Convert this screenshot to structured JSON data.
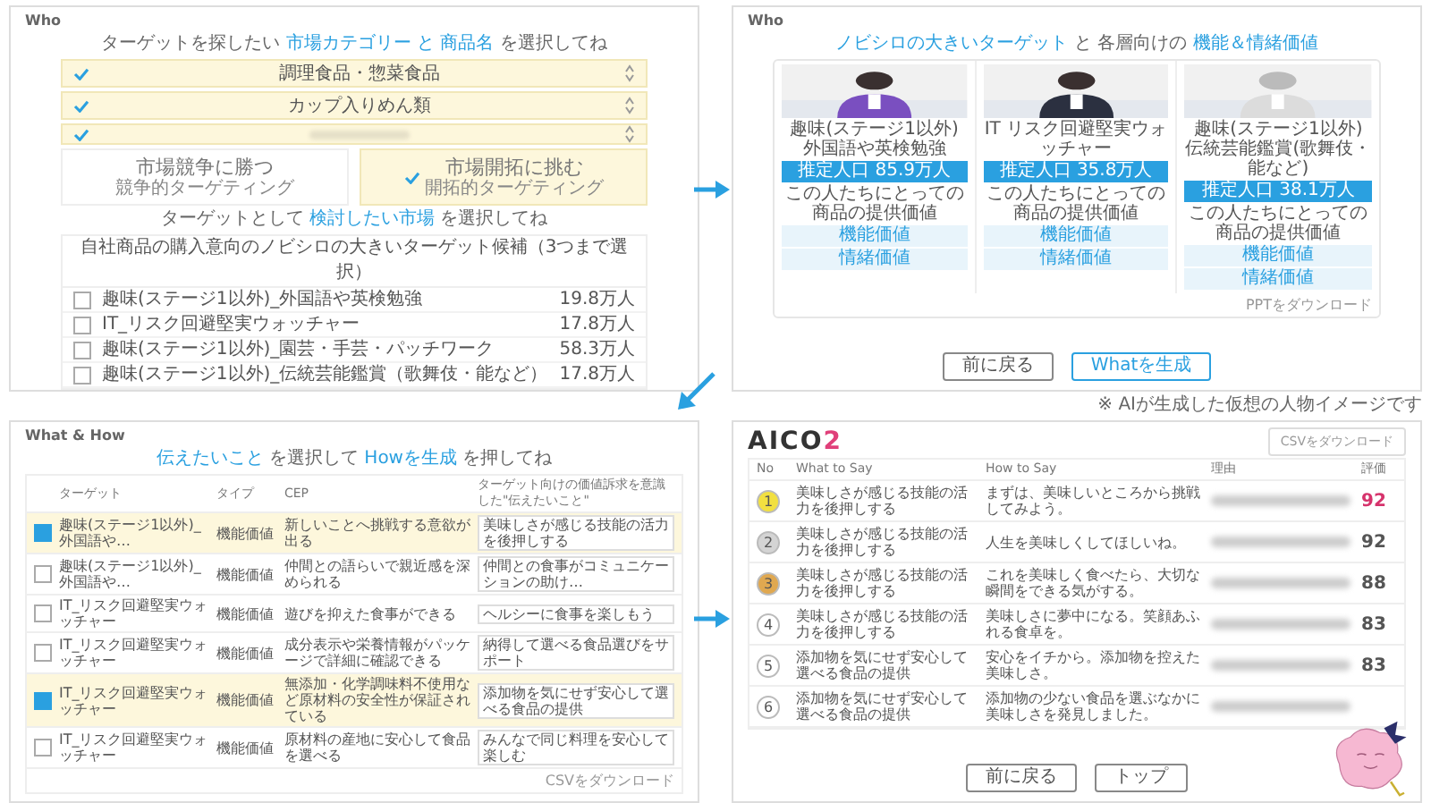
{
  "who_select": {
    "section": "Who",
    "heading": [
      {
        "text": "ターゲットを探したい ",
        "highlight": false
      },
      {
        "text": "市場カテゴリー",
        "highlight": true
      },
      {
        "text": " と ",
        "highlight": true
      },
      {
        "text": "商品名",
        "highlight": true
      },
      {
        "text": " を選択してね",
        "highlight": false
      }
    ],
    "selects": [
      {
        "value": "調理食品・惣菜食品",
        "checked": true
      },
      {
        "value": "カップ入りめん類",
        "checked": true
      },
      {
        "checked": true
      }
    ],
    "options": [
      {
        "title": "市場競争に勝つ",
        "subtitle": "競争的ターゲティング",
        "selected": false
      },
      {
        "title": "市場開拓に挑む",
        "subtitle": "開拓的ターゲティング",
        "selected": true
      }
    ],
    "heading2": [
      {
        "text": "ターゲットとして ",
        "highlight": false
      },
      {
        "text": "検討したい市場",
        "highlight": true
      },
      {
        "text": " を選択してね",
        "highlight": false
      }
    ],
    "list_header": "自社商品の購入意向のノビシロの大きいターゲット候補（3つまで選択）",
    "rows": [
      {
        "name": "趣味(ステージ1以外)_外国語や英検勉強",
        "size": "19.8万人",
        "checked": false
      },
      {
        "name": "IT_リスク回避堅実ウォッチャー",
        "size": "17.8万人",
        "checked": false
      },
      {
        "name": "趣味(ステージ1以外)_園芸・手芸・パッチワーク",
        "size": "58.3万人",
        "checked": false
      },
      {
        "name": "趣味(ステージ1以外)_伝統芸能鑑賞（歌舞伎・能など）",
        "size": "17.8万人",
        "checked": false
      }
    ]
  },
  "who_targets": {
    "section": "Who",
    "heading": [
      {
        "text": "ノビシロの大きいターゲット",
        "highlight": true
      },
      {
        "text": " と 各層向けの ",
        "highlight": false
      },
      {
        "text": "機能＆情緒価値",
        "highlight": true
      }
    ],
    "cards": [
      {
        "name": "趣味(ステージ1以外) 外国語や英検勉強",
        "count": "推定人口 85.9万人",
        "value_title": "この人たちにとっての商品の提供価値",
        "labels": [
          "機能価値",
          "情緒価値"
        ]
      },
      {
        "name": "IT リスク回避堅実ウォッチャー",
        "count": "推定人口 35.8万人",
        "value_title": "この人たちにとっての商品の提供価値",
        "labels": [
          "機能価値",
          "情緒価値"
        ]
      },
      {
        "name": "趣味(ステージ1以外) 伝統芸能鑑賞(歌舞伎・能など)",
        "count": "推定人口 38.1万人",
        "value_title": "この人たちにとっての商品の提供価値",
        "labels": [
          "機能価値",
          "情緒価値"
        ]
      }
    ],
    "download": "PPTをダウンロード",
    "buttons": [
      {
        "label": "前に戻る",
        "kind": "secondary"
      },
      {
        "label": "Whatを生成",
        "kind": "primary"
      }
    ]
  },
  "caption": "※ AIが生成した仮想の人物イメージです",
  "what_how": {
    "section": "What & How",
    "heading": [
      {
        "text": "伝えたいこと",
        "highlight": true
      },
      {
        "text": " を選択して ",
        "highlight": false
      },
      {
        "text": "Howを生成",
        "highlight": true
      },
      {
        "text": " を押してね",
        "highlight": false
      }
    ],
    "columns": [
      "ターゲット",
      "タイプ",
      "CEP",
      "ターゲット向けの価値訴求を意識した\"伝えたいこと\""
    ],
    "rows": [
      {
        "checked": true,
        "target": "趣味(ステージ1以外)_外国語や…",
        "type": "機能価値",
        "cep": "新しいことへ挑戦する意欲が出る",
        "say": "美味しさが感じる技能の活力を後押しする"
      },
      {
        "checked": false,
        "target": "趣味(ステージ1以外)_外国語や…",
        "type": "機能価値",
        "cep": "仲間との語らいで親近感を深められる",
        "say": "仲間との食事がコミュニケーションの助け…"
      },
      {
        "checked": false,
        "target": "IT_リスク回避堅実ウォッチャー",
        "type": "機能価値",
        "cep": "遊びを抑えた食事ができる",
        "say": "ヘルシーに食事を楽しもう"
      },
      {
        "checked": false,
        "target": "IT_リスク回避堅実ウォッチャー",
        "type": "機能価値",
        "cep": "成分表示や栄養情報がパッケージで詳細に確認できる",
        "say": "納得して選べる食品選びをサポート"
      },
      {
        "checked": true,
        "target": "IT_リスク回避堅実ウォッチャー",
        "type": "機能価値",
        "cep": "無添加・化学調味料不使用など原材料の安全性が保証されている",
        "say": "添加物を気にせず安心して選べる食品の提供"
      },
      {
        "checked": false,
        "target": "IT_リスク回避堅実ウォッチャー",
        "type": "機能価値",
        "cep": "原材料の産地に安心して食品を選べる",
        "say": "みんなで同じ料理を安心して楽しむ"
      }
    ],
    "download": "CSVをダウンロード"
  },
  "results": {
    "logo": "AICO",
    "logo_accent": "2",
    "download": "CSVをダウンロード",
    "columns": [
      "No",
      "What to Say",
      "How to Say",
      "理由",
      "評価"
    ],
    "rows": [
      {
        "rank": "1",
        "color": "#f2e040",
        "what": "美味しさが感じる技能の活力を後押しする",
        "how": "まずは、美味しいところから挑戦してみよう。",
        "score": "92",
        "highlight": true
      },
      {
        "rank": "2",
        "color": "#d4d4d4",
        "what": "美味しさが感じる技能の活力を後押しする",
        "how": "人生を美味しくしてほしいね。",
        "score": "92",
        "highlight": false
      },
      {
        "rank": "3",
        "color": "#e0a850",
        "what": "美味しさが感じる技能の活力を後押しする",
        "how": "これを美味しく食べたら、大切な瞬間をできる気がする。",
        "score": "88",
        "highlight": false
      },
      {
        "rank": "4",
        "color": "#ffffff",
        "what": "美味しさが感じる技能の活力を後押しする",
        "how": "美味しさに夢中になる。笑顔あふれる食卓を。",
        "score": "83",
        "highlight": false
      },
      {
        "rank": "5",
        "color": "#ffffff",
        "what": "添加物を気にせず安心して選べる食品の提供",
        "how": "安心をイチから。添加物を控えた美味しさ。",
        "score": "83",
        "highlight": false
      },
      {
        "rank": "6",
        "color": "#ffffff",
        "what": "添加物を気にせず安心して選べる食品の提供",
        "how": "添加物の少ない食品を選ぶなかに美味しさを発見しました。"
      }
    ],
    "buttons": [
      {
        "label": "前に戻る"
      },
      {
        "label": "トップ"
      }
    ]
  }
}
